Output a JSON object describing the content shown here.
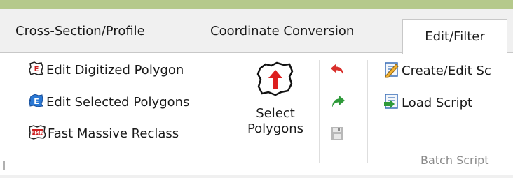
{
  "tabs": [
    "Cross-Section/Profile",
    "Coordinate Conversion",
    "Edit/Filter"
  ],
  "active_tab_index": 2,
  "polygon_tools": {
    "edit_digitized_label": "Edit Digitized Polygon",
    "edit_selected_label": "Edit Selected Polygons",
    "fast_reclass_label": "Fast Massive Reclass",
    "select_polygons_line1": "Select",
    "select_polygons_line2": "Polygons"
  },
  "batch_script": {
    "create_edit_label": "Create/Edit Sc",
    "load_script_label": "Load Script",
    "group_label": "Batch Script"
  },
  "icons": {
    "edit_digitized": "edit-digitized-polygon-icon",
    "edit_selected": "edit-selected-polygons-icon",
    "fast_reclass": "fast-massive-reclass-icon",
    "select_polygons": "select-polygons-icon",
    "undo": "undo-icon",
    "redo": "redo-icon",
    "save": "save-icon",
    "create_edit_script": "create-edit-script-icon",
    "load_script": "load-script-icon"
  },
  "colors": {
    "title_bar": "#b5c98b",
    "tab_strip": "#f0f0f0",
    "undo_red": "#d9302c",
    "redo_green": "#2e9a3a",
    "disabled_gray": "#b8b8b8",
    "group_label_gray": "#8a8a8a"
  }
}
